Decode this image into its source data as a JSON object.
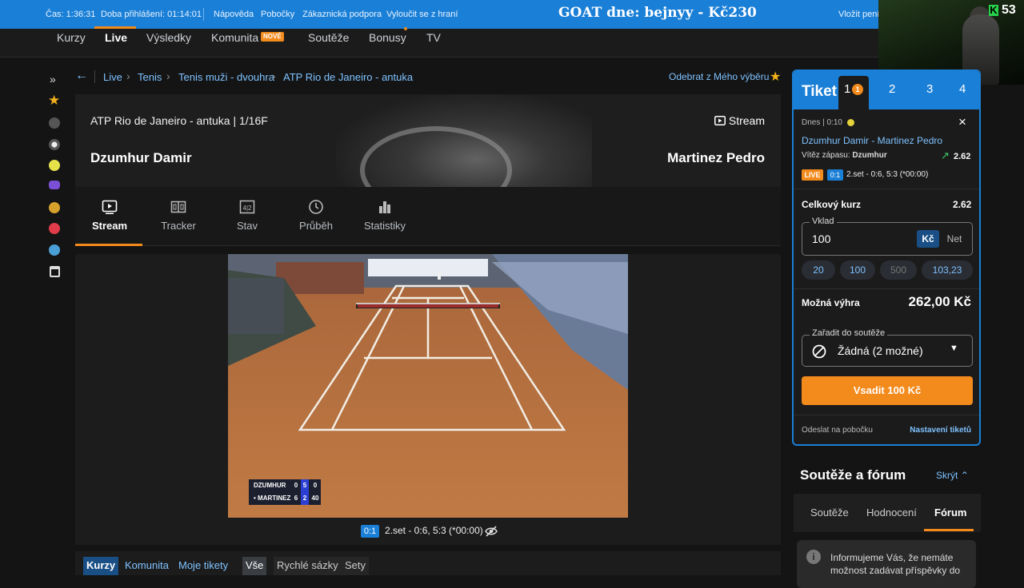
{
  "topbar": {
    "time": "Čas: 1:36:31",
    "login_duration": "Doba přihlášení: 01:14:01",
    "help": "Nápověda",
    "branches": "Pobočky",
    "support": "Zákaznická podpora",
    "exclude": "Vyloučit se z hraní",
    "deposit": "Vložit peníz",
    "goat_banner": "GOAT dne: bejnyy - Kč230"
  },
  "overlay": {
    "counter": "53",
    "logo_letter": "K"
  },
  "nav": {
    "items": [
      "Kurzy",
      "Live",
      "Výsledky",
      "Komunita",
      "Soutěže",
      "Bonusy",
      "TV"
    ],
    "active": "Live",
    "new_badge": "NOVÉ"
  },
  "breadcrumb": {
    "items": [
      "Live",
      "Tenis",
      "Tenis muži - dvouhra",
      "ATP Rio de Janeiro - antuka"
    ],
    "remove_favorite": "Odebrat z Mého výběru"
  },
  "match": {
    "tournament": "ATP Rio de Janeiro - antuka  |  1/16F",
    "player1": "Dzumhur Damir",
    "player2": "Martinez Pedro",
    "stream_label": "Stream"
  },
  "tabs": [
    "Stream",
    "Tracker",
    "Stav",
    "Průběh",
    "Statistiky"
  ],
  "scorebug": {
    "rows": [
      {
        "name": "DZUMHUR",
        "sets": "0",
        "games": "5",
        "points": "0"
      },
      {
        "name": "• MARTINEZ",
        "sets": "6",
        "games": "2",
        "points": "40"
      }
    ]
  },
  "set_info": {
    "badge": "0:1",
    "text": "2.set - 0:6, 5:3 (*00:00)"
  },
  "bottom_tabs": {
    "left": [
      "Kurzy",
      "Komunita",
      "Moje tikety"
    ],
    "right": [
      "Vše",
      "Rychlé sázky",
      "Sety"
    ]
  },
  "ticket": {
    "title": "Tiket",
    "tabs": [
      "1",
      "2",
      "3",
      "4"
    ],
    "active_count": "1",
    "date": "Dnes | 0:10",
    "match": "Dzumhur Damir - Martinez Pedro",
    "market": "Vítěz zápasu:",
    "selection": "Dzumhur",
    "odds": "2.62",
    "live_badge": "LIVE",
    "set_badge": "0:1",
    "set_text": "2.set - 0:6, 5:3 (*00:00)",
    "total_odds_label": "Celkový kurz",
    "total_odds": "2.62",
    "stake_label": "Vklad",
    "stake_value": "100",
    "currency_kc": "Kč",
    "currency_net": "Net",
    "quick_amounts": [
      "20",
      "100",
      "500",
      "103,23"
    ],
    "win_label": "Možná výhra",
    "win_value": "262,00 Kč",
    "contest_label": "Zařadit do soutěže",
    "contest_value": "Žádná (2 možné)",
    "bet_button": "Vsadit 100 Kč",
    "send_branch": "Odeslat na pobočku",
    "settings": "Nastavení tiketů"
  },
  "forum": {
    "title": "Soutěže a fórum",
    "hide": "Skrýt",
    "tabs": [
      "Soutěže",
      "Hodnocení",
      "Fórum"
    ],
    "active_tab": "Fórum",
    "notice": "Informujeme Vás, že nemáte možnost zadávat příspěvky do"
  },
  "colors": {
    "accent": "#1a7fd6",
    "orange": "#f28a1c",
    "link": "#7fc2ff"
  }
}
